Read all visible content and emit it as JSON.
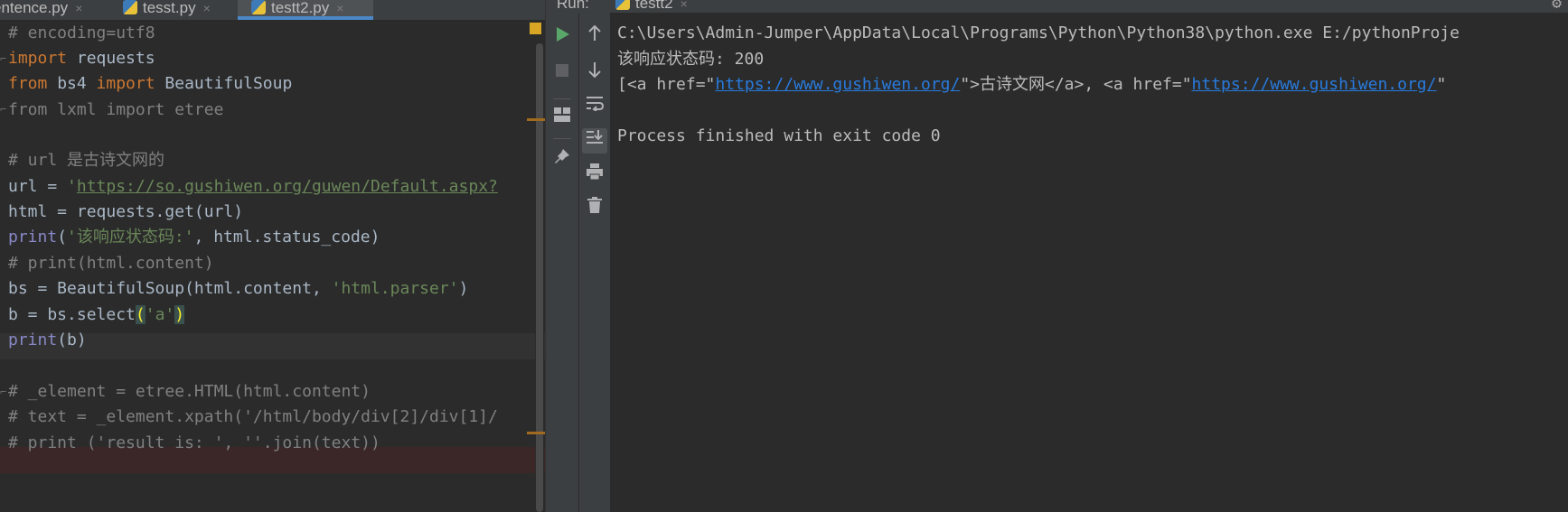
{
  "editor": {
    "tabs": [
      {
        "label": "entence.py",
        "close": "×"
      },
      {
        "label": "tesst.py",
        "close": "×"
      },
      {
        "label": "testt2.py",
        "close": "×",
        "active": true
      }
    ],
    "code": {
      "l1": "# encoding=utf8",
      "l2_kw": "import",
      "l2_rest": " requests",
      "l3_kw1": "from",
      "l3_mid": " bs4 ",
      "l3_kw2": "import",
      "l3_rest": " BeautifulSoup",
      "l4": "from lxml import etree",
      "l6": "# url 是古诗文网的",
      "l7_pre": "url = ",
      "l7_q": "'",
      "l7_url": "https://so.gushiwen.org/guwen/Default.aspx?",
      "l8": "html = requests.get(url)",
      "l9_fn": "print",
      "l9_open": "(",
      "l9_str": "'该响应状态码:'",
      "l9_rest": ", html.status_code)",
      "l10": "# print(html.content)",
      "l11_pre": "bs = BeautifulSoup(html.content, ",
      "l11_str": "'html.parser'",
      "l11_close": ")",
      "l12_pre": "b = bs.select",
      "l12_open": "(",
      "l12_str": "'a'",
      "l12_close": ")",
      "l13_fn": "print",
      "l13_rest": "(b)",
      "l15": "# _element = etree.HTML(html.content)",
      "l16": "# text = _element.xpath('/html/body/div[2]/div[1]/",
      "l17": "# print ('result is: ', ''.join(text))"
    }
  },
  "run": {
    "label": "Run:",
    "tab": "testt2",
    "tab_close": "×",
    "console": {
      "line1": "C:\\Users\\Admin-Jumper\\AppData\\Local\\Programs\\Python\\Python38\\python.exe E:/pythonProje",
      "line2": "该响应状态码: 200",
      "line3_a": "[<a href=\"",
      "line3_link1": "https://www.gushiwen.org/",
      "line3_b": "\">古诗文网</a>, <a href=\"",
      "line3_link2": "https://www.gushiwen.org/",
      "line3_c": "\"",
      "line5": "Process finished with exit code 0"
    },
    "icons": {
      "left": [
        "run-icon",
        "stop-icon",
        "layout-icon",
        "pin-icon"
      ],
      "right": [
        "arrow-up-icon",
        "arrow-down-icon",
        "soft-wrap-icon",
        "scroll-to-end-icon",
        "print-icon",
        "trash-icon"
      ]
    }
  },
  "colors": {
    "background": "#2b2b2b",
    "comment": "#808080",
    "keyword": "#cc7832",
    "string": "#6a8759",
    "builtin": "#8888c6",
    "link": "#287bde",
    "run_green": "#59a869"
  }
}
